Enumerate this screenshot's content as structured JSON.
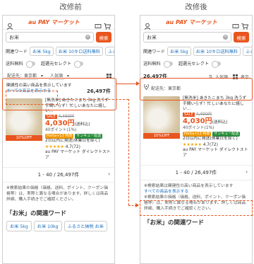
{
  "titles": {
    "before": "改修前",
    "after": "改修後"
  },
  "header": {
    "brand": "au PAY マーケット"
  },
  "search": {
    "query": "お米",
    "button": "検索"
  },
  "keywords": {
    "label": "関連ワード",
    "items": [
      "お米 5kg",
      "お米 10キロ送料無料",
      "ふるさと納"
    ]
  },
  "toggles": {
    "free_shipping": "送料無料",
    "super_select": "超選元セレクト"
  },
  "filter": {
    "delivery": "配送先：東京都",
    "sort": "人気順"
  },
  "notice": {
    "text": "関連性の高い商品を表示しています",
    "link": "すべての商品を表示する"
  },
  "count": "26,497件",
  "after_filter": {
    "sort": "人気順",
    "view": "表示"
  },
  "product": {
    "title": "[無洗米] あきたこまち 3kg 洗うず手間いらず！忙しいあなたに嬉しい…",
    "sale": "SALE",
    "orig_price": "4,490円",
    "price": "4,030円",
    "shipping": "(送料込)",
    "points": "40ポイント(1%)",
    "tag1": "Ponta+13 特典",
    "tag2": "サンキュー配送",
    "ship_date": "2日以内に発送(休業日を除く)",
    "rating": "4.7",
    "reviews": "(72)",
    "shop": "au PAY マーケット ダイレクトストア",
    "discount": "10%OFF"
  },
  "pager": "1 - 40 / 26,497件",
  "note_before": "※検索結果の価格（価格、送料、ポイント、クーポン価格等）は、実際と異なる場合があります。詳しくは商品詳細、購入手続きでご確認ください。",
  "note_after_intro": "※検索結果は関連性の高い商品を表示しています",
  "note_after_link": "すべての商品を表示する",
  "note_after_rest": "※検索結果の価格（価格、送料、ポイント、クーポン価格等）は、実際と異なる場合があります。詳しくは商品詳細、購入手続きでご確認ください。",
  "related": {
    "title": "「お米」の関連ワード",
    "items": [
      "お米 5kg",
      "お米 10kg",
      "ふるさと納税 お米"
    ]
  }
}
